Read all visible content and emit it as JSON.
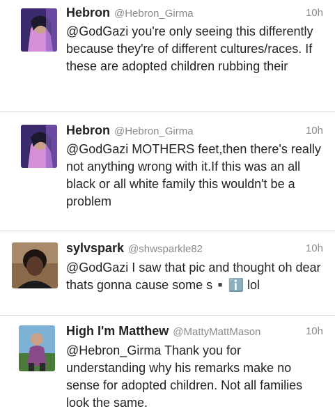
{
  "tweets": [
    {
      "name": "Hebron",
      "handle": "@Hebron_Girma",
      "time": "10h",
      "text": "@GodGazi you're only seeing this differently because they're of different cultures/races. If these are adopted children rubbing their",
      "avatar": "profile-photo"
    },
    {
      "name": "Hebron",
      "handle": "@Hebron_Girma",
      "time": "10h",
      "text": "@GodGazi MOTHERS feet,then there's really not anything wrong with it.If this was an all black or all white family this wouldn't be a problem",
      "avatar": "profile-photo"
    },
    {
      "name": "sylvspark",
      "handle": "@shwsparkle82",
      "time": "10h",
      "text": "@GodGazi I saw that pic and thought oh dear thats gonna cause some s▪️ℹ️ lol",
      "avatar": "profile-photo"
    },
    {
      "name": "High I'm Matthew",
      "handle": "@MattyMattMason",
      "time": "10h",
      "text": "@Hebron_Girma Thank you for understanding why his remarks make no sense for adopted children. Not all families look the same.",
      "avatar": "profile-photo"
    }
  ],
  "colors": {
    "background": "#ffffff",
    "name_text": "#222222",
    "meta_text": "#8a8a8a",
    "divider": "#d9d9d9"
  }
}
